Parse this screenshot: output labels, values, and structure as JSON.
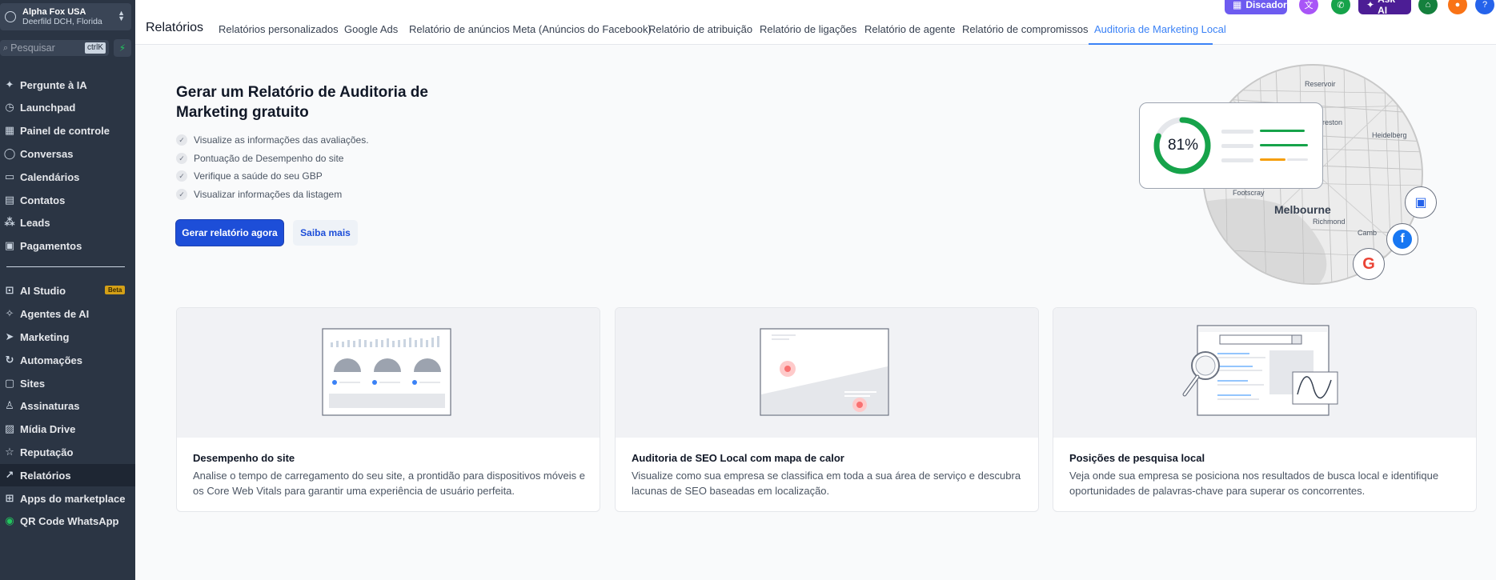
{
  "sidebar": {
    "account": {
      "name": "Alpha Fox USA",
      "location": "Deerfild DCH, Florida"
    },
    "search": {
      "placeholder": "Pesquisar",
      "shortcut": "ctrlK"
    },
    "items": [
      {
        "label": "Pergunte à IA",
        "icon": "sparkle-icon"
      },
      {
        "label": "Launchpad",
        "icon": "rocket-icon"
      },
      {
        "label": "Painel de controle",
        "icon": "dashboard-icon"
      },
      {
        "label": "Conversas",
        "icon": "chat-icon"
      },
      {
        "label": "Calendários",
        "icon": "calendar-icon"
      },
      {
        "label": "Contatos",
        "icon": "contacts-icon"
      },
      {
        "label": "Leads",
        "icon": "leads-icon"
      },
      {
        "label": "Pagamentos",
        "icon": "payments-icon"
      },
      {
        "label": "AI Studio",
        "icon": "ai-studio-icon",
        "badge": "Beta"
      },
      {
        "label": "Agentes de AI",
        "icon": "agent-icon"
      },
      {
        "label": "Marketing",
        "icon": "send-icon"
      },
      {
        "label": "Automações",
        "icon": "automation-icon"
      },
      {
        "label": "Sites",
        "icon": "sites-icon"
      },
      {
        "label": "Assinaturas",
        "icon": "membership-icon"
      },
      {
        "label": "Mídia Drive",
        "icon": "image-icon"
      },
      {
        "label": "Reputação",
        "icon": "star-icon"
      },
      {
        "label": "Relatórios",
        "icon": "chart-line-icon",
        "active": true
      },
      {
        "label": "Apps do marketplace",
        "icon": "apps-icon"
      },
      {
        "label": "QR Code WhatsApp",
        "icon": "whatsapp-icon"
      }
    ]
  },
  "header": {
    "title": "Relatórios",
    "tabs": [
      {
        "label": "Relatórios personalizados"
      },
      {
        "label": "Google Ads"
      },
      {
        "label": "Relatório de anúncios Meta (Anúncios do Facebook)"
      },
      {
        "label": "Relatório de atribuição"
      },
      {
        "label": "Relatório de ligações"
      },
      {
        "label": "Relatório de agente"
      },
      {
        "label": "Relatório de compromissos"
      },
      {
        "label": "Auditoria de Marketing Local",
        "active": true
      }
    ],
    "dialer_label": "Discador",
    "ask_ai_label": "Ask AI"
  },
  "hero": {
    "title": "Gerar um Relatório de Auditoria de Marketing gratuito",
    "checks": [
      "Visualize as informações das avaliações.",
      "Pontuação de Desempenho do site",
      "Verifique a saúde do seu GBP",
      "Visualizar informações da listagem"
    ],
    "primary_button": "Gerar relatório agora",
    "secondary_button": "Saiba mais",
    "score": "81%",
    "score_value": 81,
    "map_labels": [
      "Reservoir",
      "Preston",
      "Heidelberg",
      "Footscray",
      "Melbourne",
      "Richmond",
      "Camb"
    ]
  },
  "cards": [
    {
      "title": "Desempenho do site",
      "description": "Analise o tempo de carregamento do seu site, a prontidão para dispositivos móveis e os Core Web Vitals para garantir uma experiência de usuário perfeita."
    },
    {
      "title": "Auditoria de SEO Local com mapa de calor",
      "description": "Visualize como sua empresa se classifica em toda a sua área de serviço e descubra lacunas de SEO baseadas em localização."
    },
    {
      "title": "Posições de pesquisa local",
      "description": "Veja onde sua empresa se posiciona nos resultados de busca local e identifique oportunidades de palavras-chave para superar os concorrentes."
    }
  ],
  "colors": {
    "accent": "#3b82f6",
    "primary_button": "#1d4ed8",
    "sidebar_bg": "#2b3544",
    "score_ring": "#16a34a"
  }
}
